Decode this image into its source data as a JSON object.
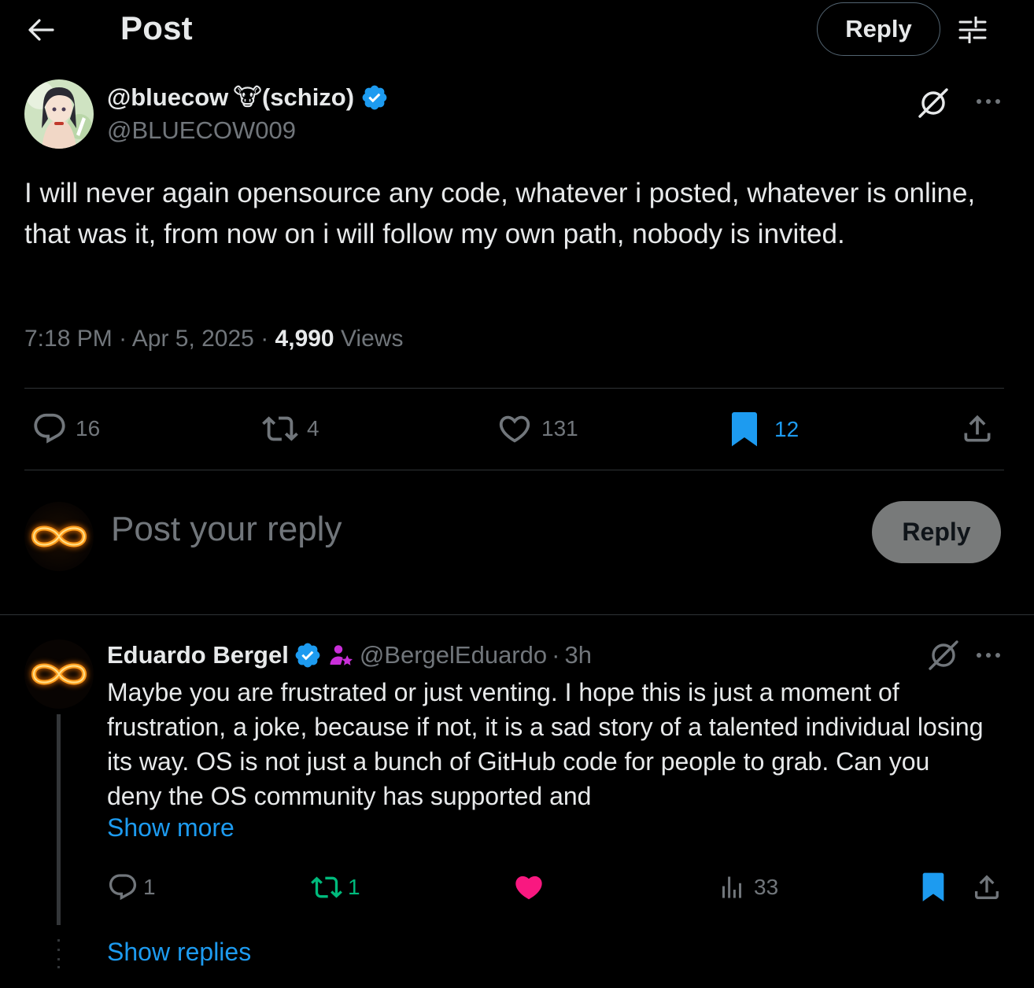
{
  "header": {
    "title": "Post",
    "reply_button": "Reply"
  },
  "post": {
    "author_name": "@bluecow",
    "author_suffix": "(schizo)",
    "author_emoji": "🐮",
    "author_handle": "@BLUECOW009",
    "text": "I will never again opensource any code, whatever i posted, whatever is online, that was it, from now on i will follow my own path, nobody is invited.",
    "time": "7:18 PM",
    "date": "Apr 5, 2025",
    "views_count": "4,990",
    "views_label": "Views",
    "replies": "16",
    "reposts": "4",
    "likes": "131",
    "bookmarks": "12"
  },
  "compose": {
    "placeholder": "Post your reply",
    "reply_button": "Reply"
  },
  "reply": {
    "author_name": "Eduardo Bergel",
    "handle": "@BergelEduardo",
    "separator": "·",
    "time": "3h",
    "text": "Maybe you are frustrated or just venting. I hope this is just a moment of frustration, a joke, because if not, it is a sad story of a talented individual losing its way. OS is not  just a bunch of GitHub code for people to grab. Can you deny the OS community has supported and",
    "show_more": "Show more",
    "replies": "1",
    "reposts": "1",
    "views": "33",
    "show_replies": "Show replies"
  },
  "colors": {
    "background": "#000000",
    "text": "#e7e9ea",
    "muted": "#71767b",
    "accent_blue": "#1d9bf0",
    "repost_green": "#00ba7c",
    "like_pink": "#f91880",
    "divider": "#2f3336"
  },
  "icons": [
    "back-arrow-icon",
    "filter-icon",
    "verified-badge-icon",
    "grok-icon",
    "more-icon",
    "reply-icon",
    "repost-icon",
    "like-icon",
    "bookmark-icon",
    "share-icon",
    "views-icon",
    "affiliate-badge-icon"
  ]
}
